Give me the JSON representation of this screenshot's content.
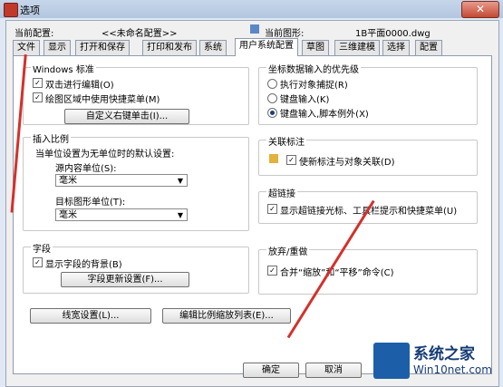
{
  "window": {
    "title": "选项",
    "close_label": "✕"
  },
  "config_row": {
    "current_config_label": "当前配置:",
    "current_config_value": "<<未命名配置>>",
    "current_drawing_label": "当前图形:",
    "current_drawing_value": "1B平面0000.dwg"
  },
  "tabs": [
    "文件",
    "显示",
    "打开和保存",
    "打印和发布",
    "系统",
    "用户系统配置",
    "草图",
    "三维建模",
    "选择",
    "配置"
  ],
  "windows_std": {
    "title": "Windows 标准",
    "opt1": "双击进行编辑(O)",
    "opt2": "绘图区域中使用快捷菜单(M)",
    "btn": "自定义右键单击(I)..."
  },
  "insert_scale": {
    "title": "插入比例",
    "desc": "当单位设置为无单位时的默认设置:",
    "src_label": "源内容单位(S):",
    "src_value": "毫米",
    "tgt_label": "目标图形单位(T):",
    "tgt_value": "毫米"
  },
  "fields": {
    "title": "字段",
    "opt": "显示字段的背景(B)",
    "btn": "字段更新设置(F)..."
  },
  "coord_priority": {
    "title": "坐标数据输入的优先级",
    "opt1": "执行对象捕捉(R)",
    "opt2": "键盘输入(K)",
    "opt3": "键盘输入,脚本例外(X)"
  },
  "assoc_dim": {
    "title": "关联标注",
    "opt": "使新标注与对象关联(D)"
  },
  "hyperlink": {
    "title": "超链接",
    "opt": "显示超链接光标、工具栏提示和快捷菜单(U)"
  },
  "undo": {
    "title": "放弃/重做",
    "opt": "合并“缩放”和“平移”命令(C)"
  },
  "bottom_buttons": {
    "lineweight": "线宽设置(L)...",
    "scale_list": "编辑比例缩放列表(E)..."
  },
  "dialog_buttons": {
    "ok": "确定",
    "cancel": "取消"
  },
  "watermark": {
    "line1": "系统之家",
    "line2": "Win10net.com"
  },
  "colors": {
    "accent": "#d3312b",
    "tab_active": "#ffffff"
  }
}
